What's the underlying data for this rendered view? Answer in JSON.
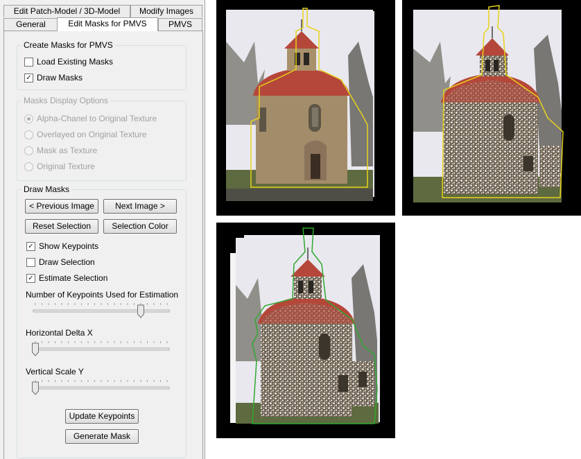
{
  "tabs_row1": [
    "Edit Patch-Model / 3D-Model",
    "Modify Images"
  ],
  "tabs_row2": [
    "General",
    "Edit Masks for PMVS",
    "PMVS"
  ],
  "create_masks": {
    "title": "Create Masks for PMVS",
    "load_existing_label": "Load Existing Masks",
    "load_existing_checked": false,
    "draw_masks_label": "Draw Masks",
    "draw_masks_checked": true
  },
  "display_options": {
    "title": "Masks Display Options",
    "options": [
      "Alpha-Chanel to Original Texture",
      "Overlayed on Original Texture",
      "Mask as Texture",
      "Original Texture"
    ],
    "selected_index": 0
  },
  "draw_masks": {
    "title": "Draw Masks",
    "prev_button": "< Previous Image",
    "next_button": "Next Image >",
    "reset_button": "Reset Selection",
    "color_button": "Selection Color",
    "show_keypoints_label": "Show Keypoints",
    "show_keypoints_checked": true,
    "draw_selection_label": "Draw Selection",
    "draw_selection_checked": false,
    "estimate_selection_label": "Estimate Selection",
    "estimate_selection_checked": true,
    "keypoints_slider_label": "Number of Keypoints Used for Estimation",
    "keypoints_slider_value": 0.8,
    "delta_x_label": "Horizontal Delta X",
    "delta_x_value": 0,
    "scale_y_label": "Vertical Scale Y",
    "scale_y_value": 0,
    "update_button": "Update Keypoints",
    "generate_button": "Generate Mask"
  },
  "colors": {
    "mask_outline_yellow": "#e8d21c",
    "mask_outline_green": "#2fa82f",
    "roof": "#b5473a",
    "stone": "#a08a68",
    "sky": "#e9e8ef"
  },
  "images": [
    "church-mask-alpha",
    "church-keypoints-yellow",
    "church-keypoints-green"
  ]
}
